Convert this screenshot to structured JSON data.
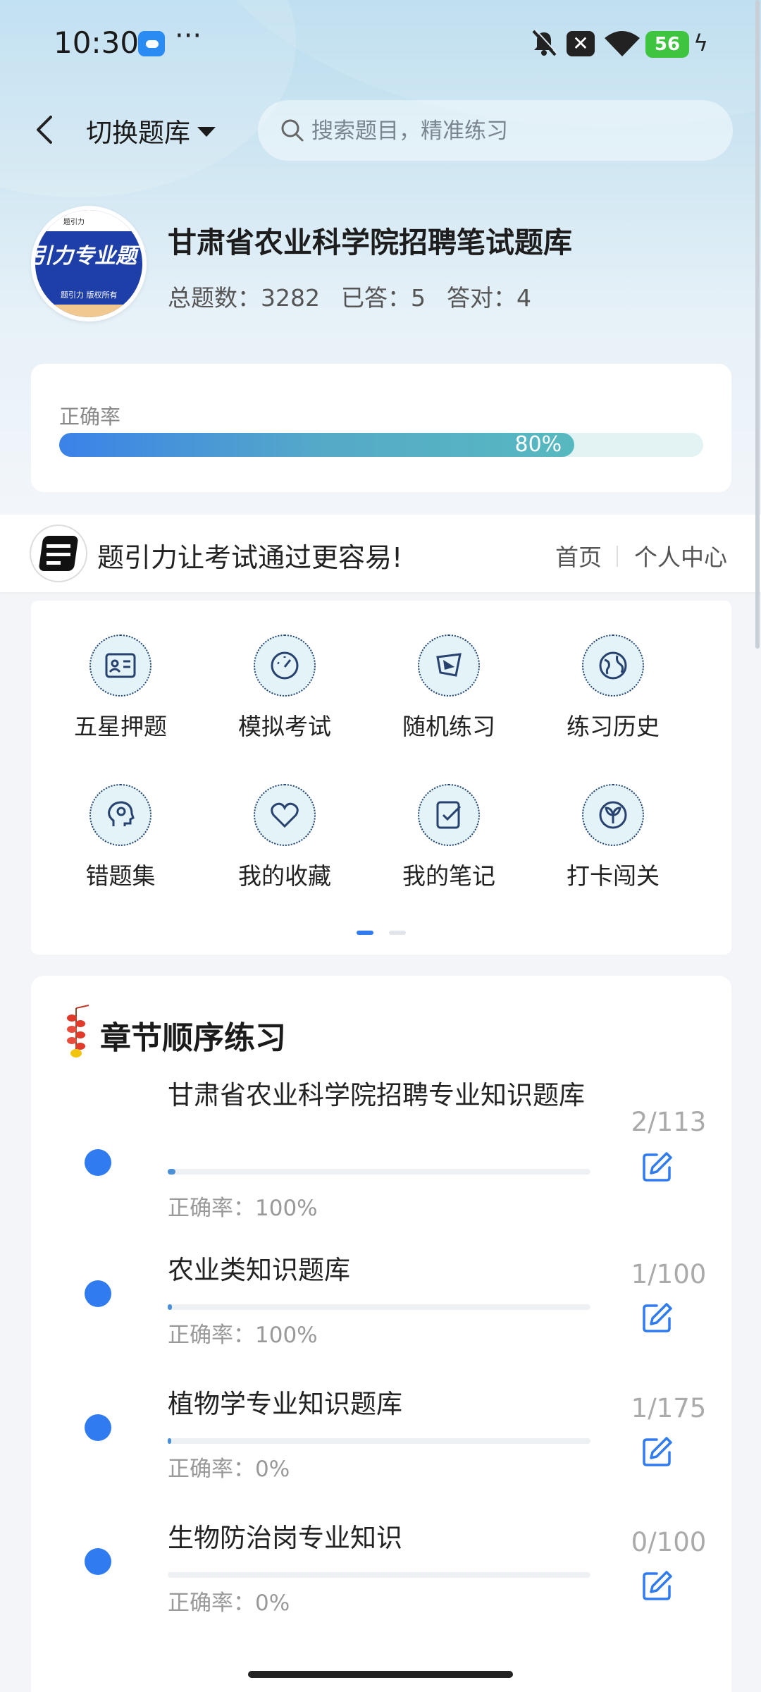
{
  "status_bar": {
    "time": "10:30",
    "more": "···",
    "notif_x": "✕",
    "battery": "56",
    "charging": "ϟ"
  },
  "header": {
    "switch_label": "切换题库",
    "search_placeholder": "搜索题目，精准练习"
  },
  "bank": {
    "logo_top": "题引力",
    "logo_text": "引力专业题",
    "logo_sub": "题引力 版权所有",
    "title": "甘肃省农业科学院招聘笔试题库",
    "total": "总题数：3282",
    "answered": "已答：5",
    "correct": "答对：4"
  },
  "accuracy": {
    "label": "正确率",
    "value": 0.8,
    "text": "80%"
  },
  "slogan": {
    "text": "题引力让考试通过更容易!",
    "home": "首页",
    "me": "个人中心"
  },
  "features": [
    {
      "label": "五星押题",
      "icon": "id-card-icon"
    },
    {
      "label": "模拟考试",
      "icon": "gauge-icon"
    },
    {
      "label": "随机练习",
      "icon": "random-icon"
    },
    {
      "label": "练习历史",
      "icon": "globe-icon"
    },
    {
      "label": "错题集",
      "icon": "head-icon"
    },
    {
      "label": "我的收藏",
      "icon": "heart-icon"
    },
    {
      "label": "我的笔记",
      "icon": "note-check-icon"
    },
    {
      "label": "打卡闯关",
      "icon": "sprout-icon"
    }
  ],
  "pager": {
    "count": 2,
    "active": 0
  },
  "chapters": {
    "title": "章节顺序练习",
    "items": [
      {
        "name": "甘肃省农业科学院招聘专业知识题库",
        "accuracy": "正确率：100%",
        "count": "2/113",
        "progress": 0.018
      },
      {
        "name": "农业类知识题库",
        "accuracy": "正确率：100%",
        "count": "1/100",
        "progress": 0.01
      },
      {
        "name": "植物学专业知识题库",
        "accuracy": "正确率：0%",
        "count": "1/175",
        "progress": 0.006
      },
      {
        "name": "生物防治岗专业知识",
        "accuracy": "正确率：0%",
        "count": "0/100",
        "progress": 0.0
      }
    ]
  },
  "colors": {
    "accent": "#2f7bef",
    "progress_start": "#3b82e8",
    "progress_end": "#57b9c0"
  }
}
